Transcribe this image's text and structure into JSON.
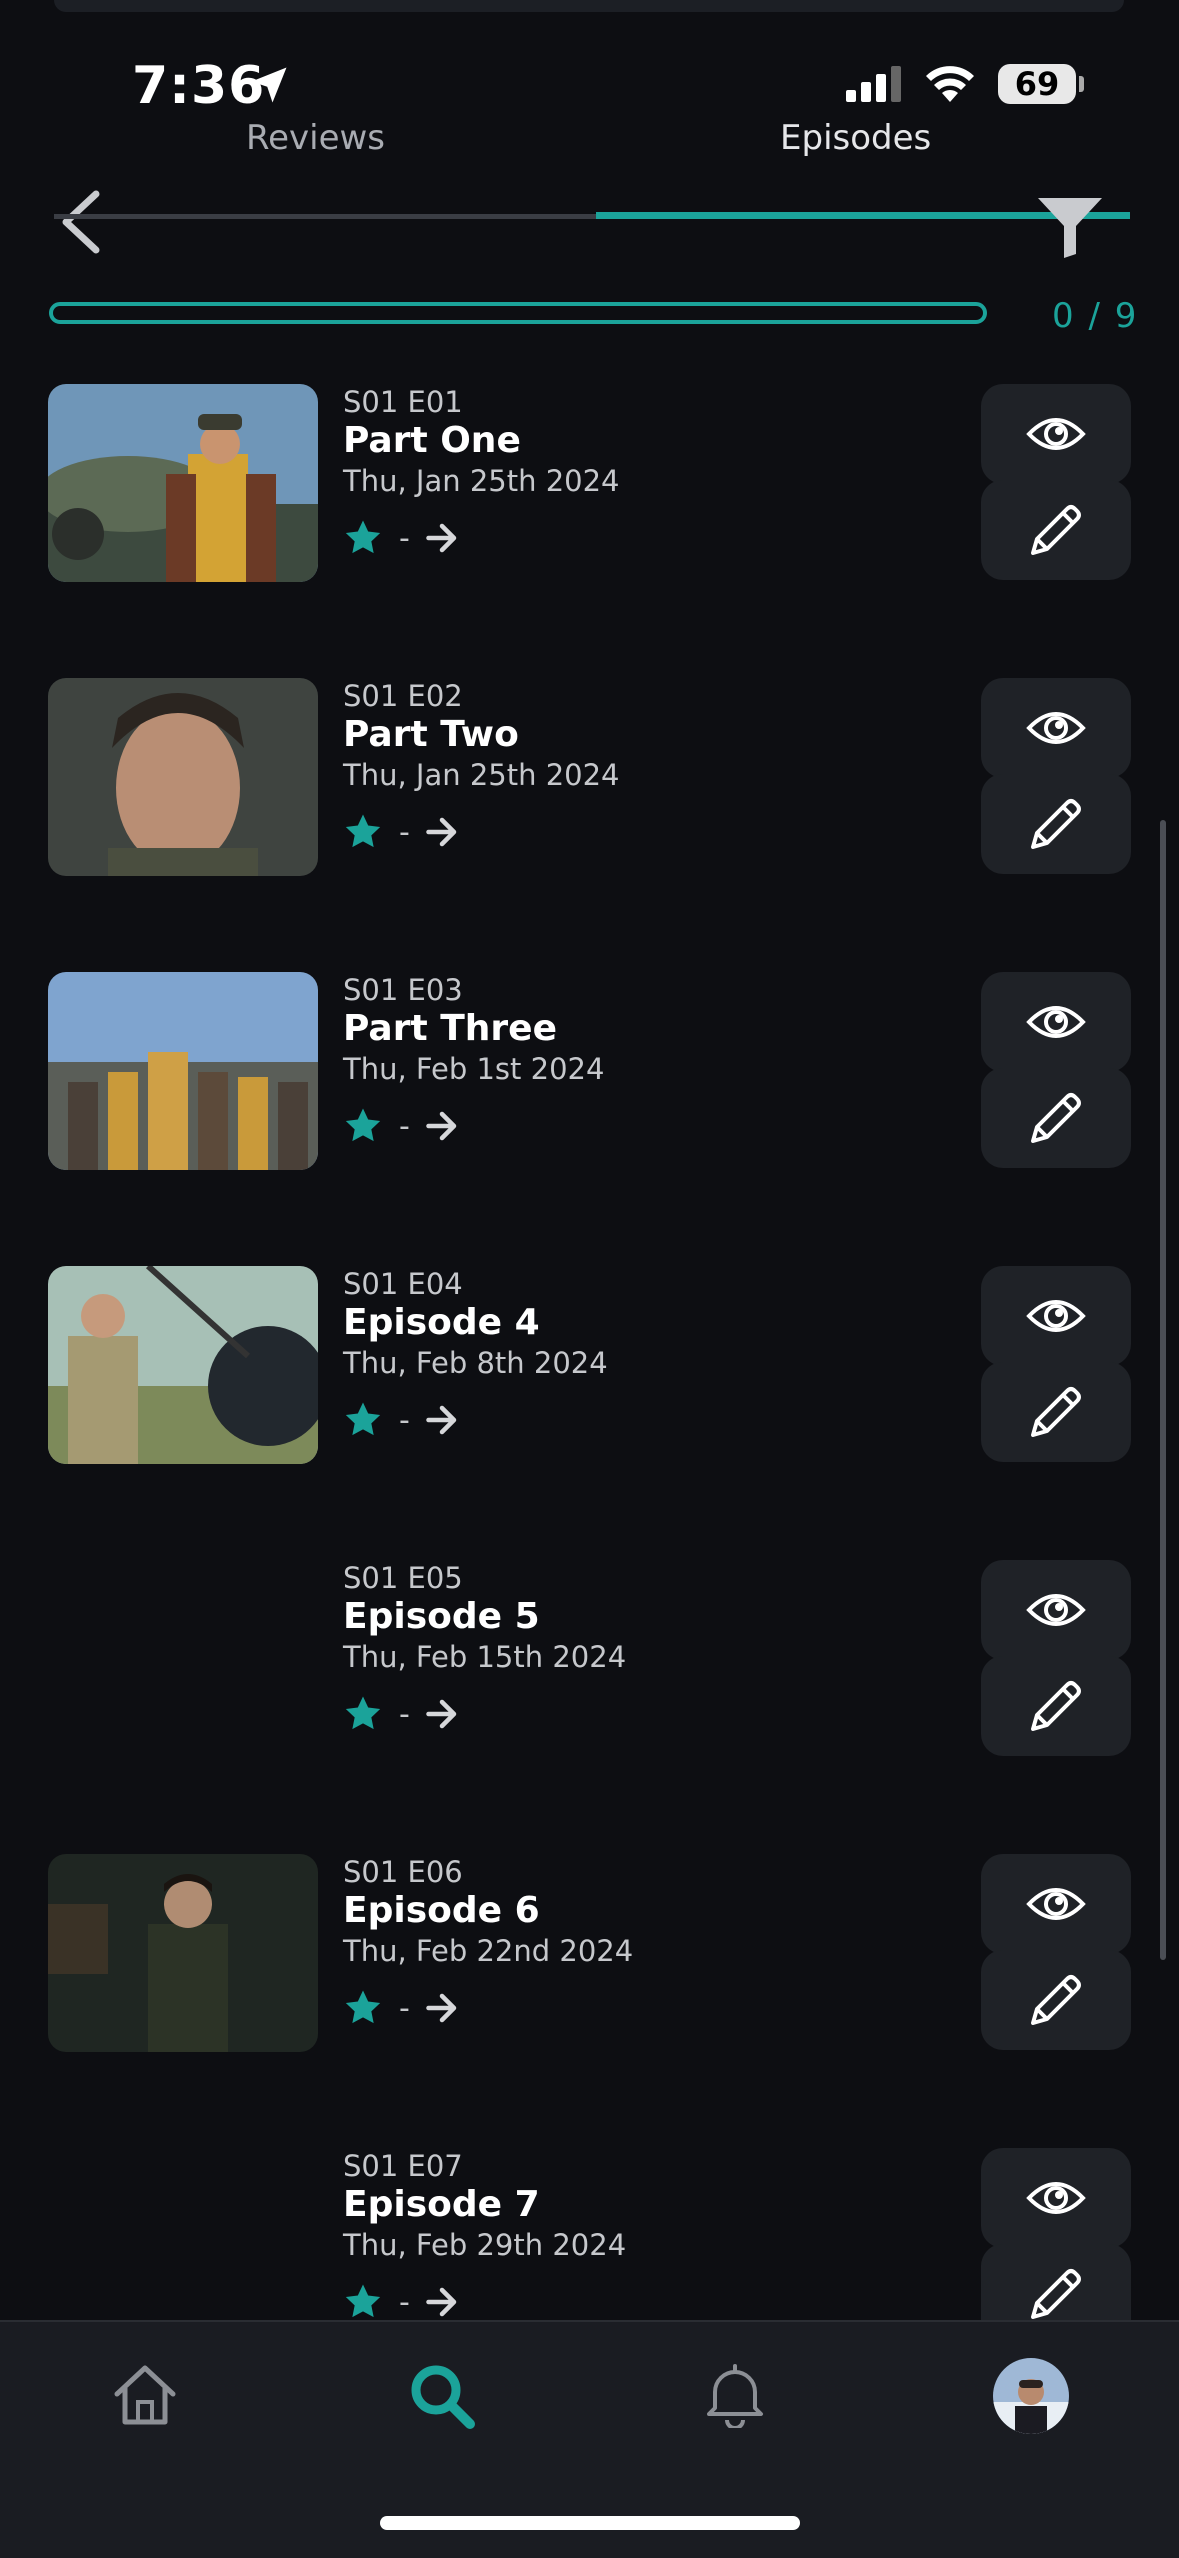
{
  "status_bar": {
    "time": "7:36",
    "battery": "69"
  },
  "nav_tabs": [
    {
      "label": "Reviews",
      "active": false
    },
    {
      "label": "Episodes",
      "active": true
    }
  ],
  "progress": {
    "watched": 0,
    "total": 9,
    "text": "0 / 9",
    "fraction": 0
  },
  "colors": {
    "accent": "#1ba39a",
    "background": "#0d0e12",
    "card": "#1f2227"
  },
  "episodes": [
    {
      "code": "S01 E01",
      "title": "Part One",
      "date": "Thu, Jan 25th 2024",
      "rating": "-",
      "has_image": true
    },
    {
      "code": "S01 E02",
      "title": "Part Two",
      "date": "Thu, Jan 25th 2024",
      "rating": "-",
      "has_image": true
    },
    {
      "code": "S01 E03",
      "title": "Part Three",
      "date": "Thu, Feb 1st 2024",
      "rating": "-",
      "has_image": true
    },
    {
      "code": "S01 E04",
      "title": "Episode 4",
      "date": "Thu, Feb 8th 2024",
      "rating": "-",
      "has_image": true
    },
    {
      "code": "S01 E05",
      "title": "Episode 5",
      "date": "Thu, Feb 15th 2024",
      "rating": "-",
      "has_image": false
    },
    {
      "code": "S01 E06",
      "title": "Episode 6",
      "date": "Thu, Feb 22nd 2024",
      "rating": "-",
      "has_image": true
    },
    {
      "code": "S01 E07",
      "title": "Episode 7",
      "date": "Thu, Feb 29th 2024",
      "rating": "-",
      "has_image": false
    }
  ],
  "icons": {
    "back": "chevron-left-icon",
    "filter": "filter-icon",
    "watched": "eye-icon",
    "edit": "pencil-icon",
    "rating": "star-icon",
    "open": "arrow-right-icon",
    "home": "home-icon",
    "search": "search-icon",
    "notifications": "bell-icon",
    "profile": "avatar"
  },
  "bottom_nav": {
    "active": "search"
  }
}
